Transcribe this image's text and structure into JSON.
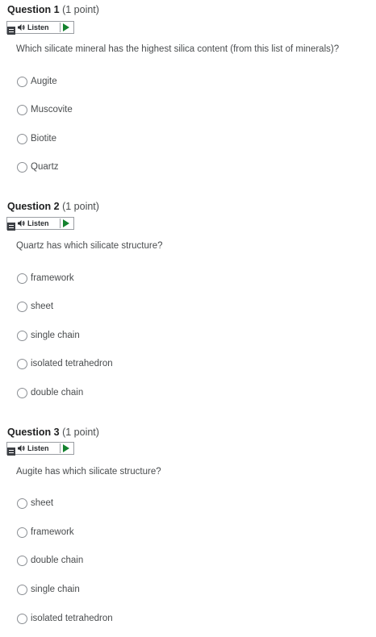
{
  "questions": [
    {
      "label": "Question 1",
      "points": "(1 point)",
      "listen_label": "Listen",
      "text": "Which silicate mineral has the highest silica content (from this list of minerals)?",
      "options": [
        "Augite",
        "Muscovite",
        "Biotite",
        "Quartz"
      ]
    },
    {
      "label": "Question 2",
      "points": "(1 point)",
      "listen_label": "Listen",
      "text": "Quartz has which silicate structure?",
      "options": [
        "framework",
        "sheet",
        "single chain",
        "isolated tetrahedron",
        "double chain"
      ]
    },
    {
      "label": "Question 3",
      "points": "(1 point)",
      "listen_label": "Listen",
      "text": "Augite has which silicate structure?",
      "options": [
        "sheet",
        "framework",
        "double chain",
        "single chain",
        "isolated tetrahedron"
      ]
    }
  ],
  "colors": {
    "play_icon": "#14822e",
    "text": "#494c4e",
    "title": "#202122",
    "border": "#9a9ea3"
  }
}
